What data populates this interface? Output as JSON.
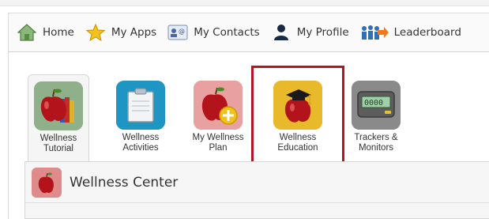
{
  "nav": {
    "items": [
      {
        "label": "Home",
        "icon": "home-icon"
      },
      {
        "label": "My Apps",
        "icon": "star-icon"
      },
      {
        "label": "My Contacts",
        "icon": "contact-card-icon"
      },
      {
        "label": "My Profile",
        "icon": "person-icon"
      },
      {
        "label": "Leaderboard",
        "icon": "leaderboard-icon"
      }
    ]
  },
  "tabs": [
    {
      "line1": "Wellness",
      "line2": "Tutorial",
      "icon": "apple-books-icon"
    },
    {
      "line1": "Wellness",
      "line2": "Activities",
      "icon": "clipboard-icon"
    },
    {
      "line1": "My Wellness",
      "line2": "Plan",
      "icon": "apple-plus-icon"
    },
    {
      "line1": "Wellness",
      "line2": "Education",
      "icon": "apple-graduation-cap-icon"
    },
    {
      "line1": "Trackers &",
      "line2": "Monitors",
      "icon": "pedometer-icon"
    }
  ],
  "section": {
    "title": "Wellness Center",
    "icon": "apple-icon"
  },
  "colors": {
    "highlight": "#b01722",
    "tutorial_bg": "#8fb08b",
    "activities_bg": "#1f95c4",
    "plan_bg": "#e8a0a0",
    "education_bg": "#e8b92a",
    "trackers_bg": "#8a8a8a"
  }
}
